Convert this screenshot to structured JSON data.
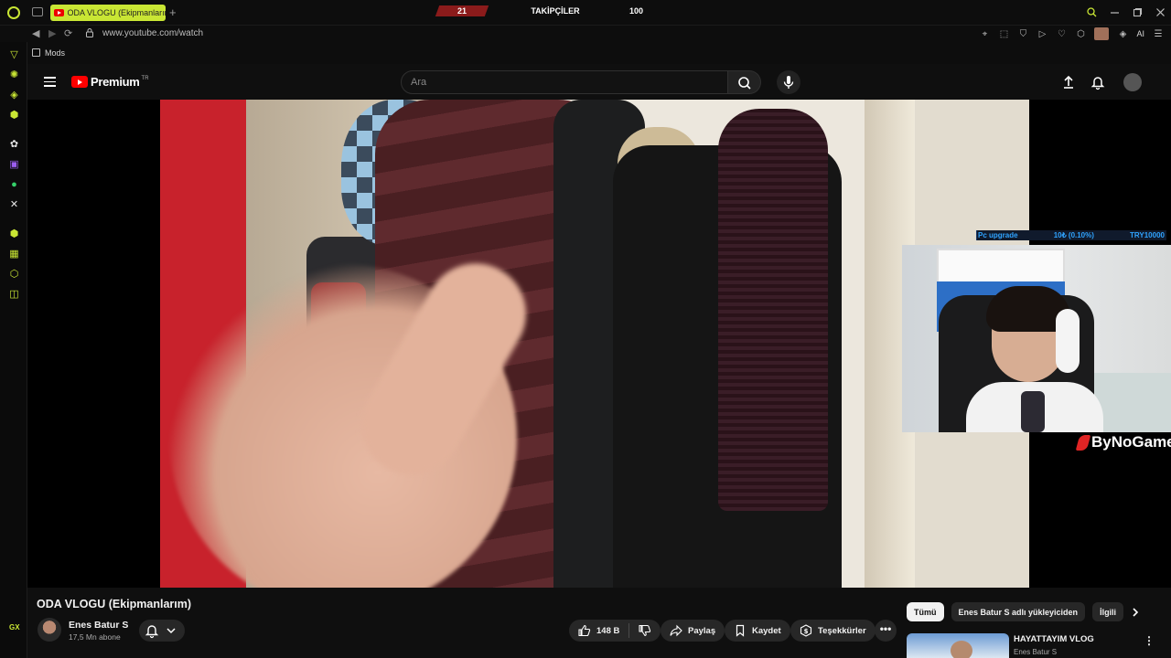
{
  "browser": {
    "tab_title": "ODA VLOGU (Ekipmanlarım)",
    "new_tab_icon": "+",
    "url": "www.youtube.com/watch",
    "bookmark_label": "Mods",
    "ai_label": "AI",
    "accent_color": "#c9e634"
  },
  "stream_bar": {
    "left_value": "21",
    "label": "TAKİPÇİLER",
    "right_value": "100"
  },
  "youtube": {
    "logo_text": "Premium",
    "country_code": "TR",
    "search_placeholder": "Ara"
  },
  "overlay": {
    "goal_label": "Pc upgrade",
    "goal_progress_text": "10₺ (0.10%)",
    "goal_progress_fraction": 0.001,
    "goal_target": "TRY10000",
    "brand_text": "ByNoGame"
  },
  "video": {
    "title": "ODA VLOGU (Ekipmanlarım)",
    "channel_name": "Enes Batur S",
    "subscribers": "17,5 Mn abone",
    "likes": "148 B",
    "share_label": "Paylaş",
    "save_label": "Kaydet",
    "thanks_label": "Teşekkürler",
    "more_icon": "•••"
  },
  "sidebar_chips": {
    "items": [
      "Tümü",
      "Enes Batur S adlı yükleyiciden",
      "İlgili"
    ]
  },
  "recommendation": {
    "title": "HAYATTAYIM VLOG",
    "channel": "Enes Batur S"
  },
  "gx_sidebar": {
    "bottom_label": "GX"
  }
}
